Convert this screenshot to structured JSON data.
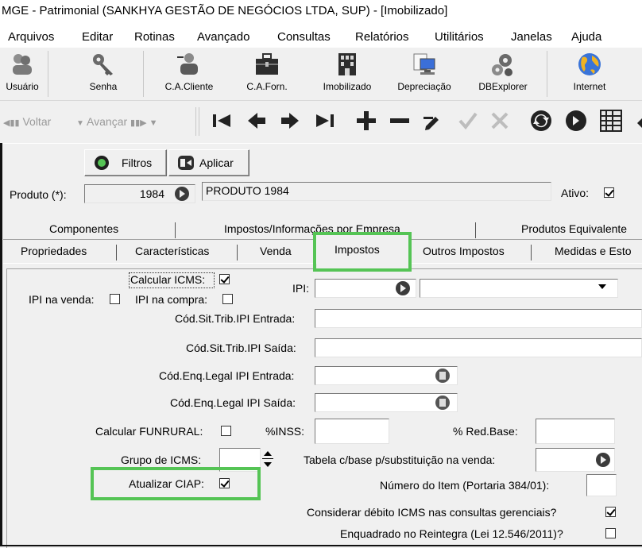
{
  "window": {
    "title": "MGE - Patrimonial (SANKHYA GESTÃO DE NEGÓCIOS LTDA, SUP) - [Imobilizado]"
  },
  "menu": [
    "Arquivos",
    "Editar",
    "Rotinas",
    "Avançado",
    "Consultas",
    "Relatórios",
    "Utilitários",
    "Janelas",
    "Ajuda"
  ],
  "toolbar": {
    "usuario": "Usuário",
    "senha": "Senha",
    "ca_cliente": "C.A.Cliente",
    "ca_forn": "C.A.Forn.",
    "imobilizado": "Imobilizado",
    "depreciacao": "Depreciação",
    "dbexplorer": "DBExplorer",
    "internet": "Internet"
  },
  "nav": {
    "voltar": "Voltar",
    "avancar": "Avançar"
  },
  "filter": {
    "filtros": "Filtros",
    "aplicar": "Aplicar"
  },
  "produto": {
    "label": "Produto (*):",
    "code": "1984",
    "name": "PRODUTO 1984",
    "ativo_label": "Ativo:",
    "ativo_checked": true
  },
  "tabs_top": [
    "Componentes",
    "Impostos/Informações por Empresa",
    "Produtos Equivalente"
  ],
  "tabs_bottom": [
    "Propriedades",
    "Características",
    "Venda",
    "Impostos",
    "Outros Impostos",
    "Medidas e Esto"
  ],
  "form": {
    "calcular_icms": "Calcular ICMS:",
    "ipi_venda": "IPI na venda:",
    "ipi_compra": "IPI na compra:",
    "ipi": "IPI:",
    "cod_sit_trib_ipi_entrada": "Cód.Sit.Trib.IPI Entrada:",
    "cod_sit_trib_ipi_saida": "Cód.Sit.Trib.IPI Saída:",
    "cod_enq_legal_ipi_entrada": "Cód.Enq.Legal IPI Entrada:",
    "cod_enq_legal_ipi_saida": "Cód.Enq.Legal IPI Saída:",
    "calcular_funrural": "Calcular FUNRURAL:",
    "pct_inss": "%INSS:",
    "pct_red_base": "% Red.Base:",
    "grupo_icms": "Grupo de ICMS:",
    "tabela_cbase": "Tabela c/base p/substituição na venda:",
    "atualizar_ciap": "Atualizar CIAP:",
    "numero_item": "Número do Item (Portaria 384/01):",
    "considerar_debito": "Considerar débito ICMS nas consultas gerenciais?",
    "enquadrado_reintegra": "Enquadrado no Reintegra (Lei 12.546/2011)?"
  },
  "colors": {
    "highlight": "#55c455",
    "globe": "#f0b323"
  }
}
